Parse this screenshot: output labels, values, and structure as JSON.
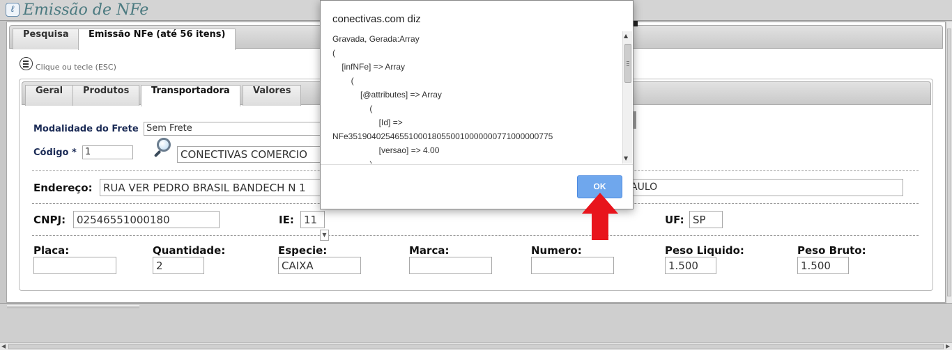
{
  "app": {
    "title": "Emissão de NFe"
  },
  "main_tabs": [
    {
      "label": "Pesquisa"
    },
    {
      "label": "Emissão NFe (até 56 itens)"
    }
  ],
  "close_hint": "Clique ou tecle (ESC)",
  "inner_tabs": [
    {
      "label": "Geral"
    },
    {
      "label": "Produtos"
    },
    {
      "label": "Transportadora"
    },
    {
      "label": "Valores"
    }
  ],
  "form": {
    "modalidade": {
      "label": "Modalidade do Frete",
      "value": "Sem Frete"
    },
    "codigo": {
      "label": "Código *",
      "value": "1",
      "name_value": "CONECTIVAS COMERCIO"
    },
    "endereco": {
      "label": "Endereço:",
      "value": "RUA VER PEDRO BRASIL BANDECH N 1",
      "city_value": "AULO"
    },
    "cnpj": {
      "label": "CNPJ:",
      "value": "02546551000180"
    },
    "ie": {
      "label": "IE:",
      "value": "11"
    },
    "uf": {
      "label": "UF:",
      "value": "SP"
    },
    "placa": {
      "label": "Placa:",
      "value": ""
    },
    "quantidade": {
      "label": "Quantidade:",
      "value": "2"
    },
    "especie": {
      "label": "Especie:",
      "value": "CAIXA"
    },
    "marca": {
      "label": "Marca:",
      "value": ""
    },
    "numero": {
      "label": "Numero:",
      "value": ""
    },
    "peso_liquido": {
      "label": "Peso Liquido:",
      "value": "1.500"
    },
    "peso_bruto": {
      "label": "Peso Bruto:",
      "value": "1.500"
    }
  },
  "dialog": {
    "title": "conectivas.com diz",
    "lines": [
      "Gravada, Gerada:Array",
      "(",
      "    [infNFe] => Array",
      "        (",
      "            [@attributes] => Array",
      "                (",
      "                    [Id] =>",
      "NFe35190402546551000180550010000000771000000775",
      "                    [versao] => 4.00",
      "                )"
    ],
    "ok_label": "OK"
  },
  "colors": {
    "ok_button": "#6fa7ed",
    "annotation_arrow": "#e8141c",
    "title_text": "#4b7a80"
  },
  "icons": {
    "logo": "app-logo-icon",
    "close": "hamburger-circle-icon",
    "search": "magnifier-icon",
    "annotation": "red-arrow-icon"
  }
}
